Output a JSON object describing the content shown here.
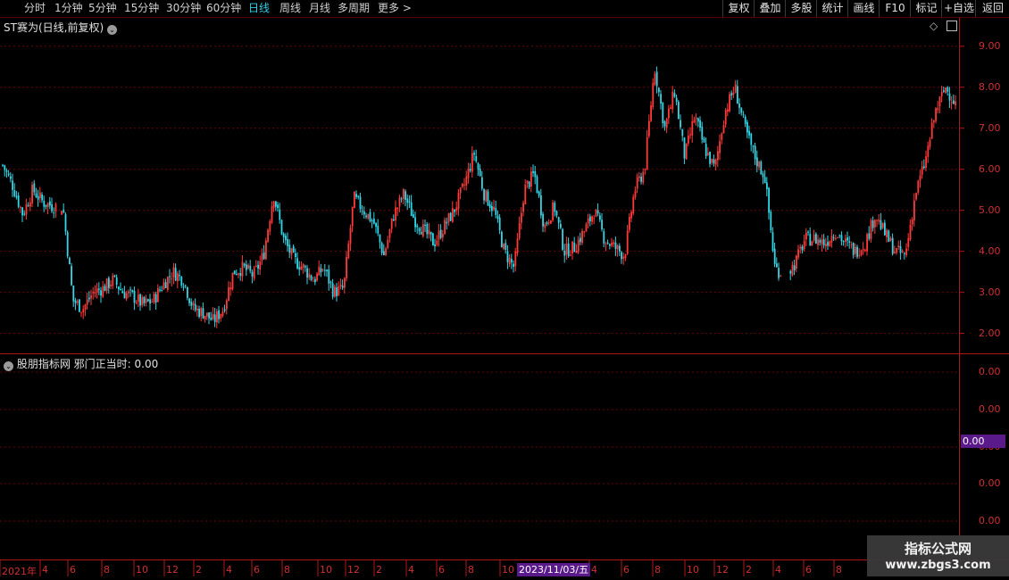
{
  "toolbar": {
    "tabs": [
      "分时",
      "1分钟",
      "5分钟",
      "15分钟",
      "30分钟",
      "60分钟",
      "日线",
      "周线",
      "月线",
      "多周期",
      "更多 >"
    ],
    "active_tab": "日线",
    "right_buttons": [
      "复权",
      "叠加",
      "多股",
      "统计",
      "画线",
      "F10",
      "标记",
      "+自选",
      "返回"
    ]
  },
  "main_panel": {
    "title": "ST赛为(日线,前复权)",
    "price_labels": [
      "9.00",
      "8.00",
      "7.00",
      "6.00",
      "5.00",
      "4.00",
      "3.00",
      "2.00"
    ]
  },
  "indicator_panel": {
    "title": "股朋指标网  邪门正当时: 0.00",
    "value_labels": [
      "0.00",
      "0.00",
      "0.00",
      "0.00",
      "0.00"
    ],
    "current_value": "0.00"
  },
  "x_axis": {
    "labels": [
      "2021年",
      "4",
      "6",
      "8",
      "10",
      "12",
      "2",
      "4",
      "6",
      "8",
      "10",
      "12",
      "2",
      "4",
      "6",
      "8",
      "10",
      "4",
      "6",
      "8",
      "10",
      "12",
      "2",
      "4",
      "6",
      "8"
    ],
    "cursor_date": "2023/11/03/五"
  },
  "watermark": {
    "line1": "指标公式网",
    "line2": "www.zbgs3.com"
  },
  "colors": {
    "up": "#ff3a3a",
    "down": "#33d6e6",
    "grid": "#6a0000",
    "axis": "#c02020",
    "highlight": "#5a1a8a"
  },
  "chart_data": {
    "type": "candlestick",
    "title": "ST赛为(日线,前复权)",
    "ylim": [
      1.6,
      9.3
    ],
    "yticks": [
      2,
      3,
      4,
      5,
      6,
      7,
      8,
      9
    ],
    "close_path": [
      [
        0,
        6.1
      ],
      [
        1,
        5.6
      ],
      [
        2,
        4.9
      ],
      [
        3,
        5.5
      ],
      [
        4,
        5.2
      ],
      [
        5,
        5.1
      ],
      [
        6,
        5.1
      ],
      [
        7,
        2.8
      ],
      [
        8,
        2.6
      ],
      [
        9,
        3.0
      ],
      [
        10,
        3.1
      ],
      [
        11,
        3.3
      ],
      [
        12,
        3.0
      ],
      [
        13,
        2.9
      ],
      [
        14,
        2.7
      ],
      [
        15,
        2.8
      ],
      [
        16,
        3.2
      ],
      [
        17,
        3.5
      ],
      [
        18,
        3.3
      ],
      [
        19,
        2.6
      ],
      [
        20,
        2.5
      ],
      [
        21,
        2.3
      ],
      [
        22,
        2.6
      ],
      [
        23,
        3.5
      ],
      [
        24,
        3.6
      ],
      [
        25,
        3.4
      ],
      [
        26,
        3.9
      ],
      [
        27,
        5.4
      ],
      [
        28,
        4.3
      ],
      [
        29,
        3.8
      ],
      [
        30,
        3.6
      ],
      [
        31,
        3.3
      ],
      [
        32,
        3.6
      ],
      [
        33,
        3.0
      ],
      [
        34,
        3.1
      ],
      [
        35,
        5.3
      ],
      [
        36,
        5.0
      ],
      [
        37,
        4.7
      ],
      [
        38,
        3.9
      ],
      [
        39,
        4.9
      ],
      [
        40,
        5.4
      ],
      [
        41,
        4.8
      ],
      [
        42,
        4.5
      ],
      [
        43,
        4.2
      ],
      [
        44,
        4.6
      ],
      [
        45,
        5.0
      ],
      [
        46,
        5.6
      ],
      [
        47,
        6.4
      ],
      [
        48,
        5.4
      ],
      [
        49,
        5.0
      ],
      [
        50,
        4.0
      ],
      [
        51,
        3.6
      ],
      [
        52,
        5.5
      ],
      [
        53,
        5.9
      ],
      [
        54,
        4.6
      ],
      [
        55,
        5.1
      ],
      [
        56,
        4.0
      ],
      [
        57,
        4.1
      ],
      [
        58,
        4.5
      ],
      [
        59,
        5.0
      ],
      [
        60,
        4.3
      ],
      [
        61,
        4.1
      ],
      [
        62,
        3.9
      ],
      [
        63,
        5.5
      ],
      [
        64,
        6.0
      ],
      [
        65,
        8.5
      ],
      [
        66,
        7.0
      ],
      [
        67,
        7.9
      ],
      [
        68,
        6.3
      ],
      [
        69,
        7.3
      ],
      [
        70,
        6.5
      ],
      [
        71,
        6.0
      ],
      [
        72,
        7.4
      ],
      [
        73,
        8.0
      ],
      [
        74,
        7.0
      ],
      [
        75,
        6.3
      ],
      [
        76,
        5.8
      ],
      [
        77,
        3.6
      ],
      [
        78,
        3.4
      ],
      [
        79,
        3.7
      ],
      [
        80,
        4.3
      ],
      [
        81,
        4.3
      ],
      [
        82,
        4.2
      ],
      [
        83,
        4.5
      ],
      [
        84,
        4.2
      ],
      [
        85,
        4.0
      ],
      [
        86,
        4.2
      ],
      [
        87,
        4.9
      ],
      [
        88,
        4.4
      ],
      [
        89,
        4.0
      ],
      [
        90,
        3.9
      ],
      [
        91,
        5.4
      ],
      [
        92,
        6.2
      ],
      [
        93,
        7.4
      ],
      [
        94,
        8.0
      ],
      [
        95,
        7.6
      ]
    ]
  }
}
